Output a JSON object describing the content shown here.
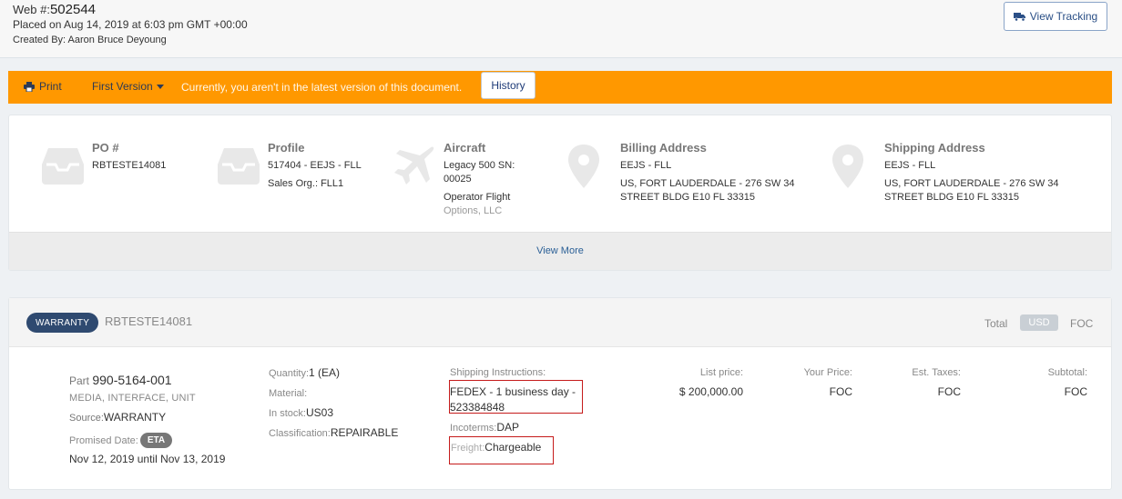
{
  "header": {
    "web_label": "Web #:",
    "web_number": "502544",
    "placed": "Placed on Aug 14, 2019 at 6:03 pm GMT +00:00",
    "created_by": "Created By: Aaron Bruce Deyoung",
    "tracking_button": "View Tracking"
  },
  "toolbar": {
    "print_label": "Print",
    "version_label": "First Version",
    "message": "Currently, you aren't in the latest version of this document.",
    "history_label": "History",
    "bar_color": "#ff9800"
  },
  "info": {
    "po": {
      "title": "PO #",
      "value": "RBTESTE14081"
    },
    "profile": {
      "title": "Profile",
      "line1": "517404 - EEJS - FLL",
      "line2": "Sales Org.: FLL1"
    },
    "aircraft": {
      "title": "Aircraft",
      "line1": "Legacy 500 SN:",
      "line2": "00025",
      "line3": "Operator Flight",
      "line4": "Options, LLC"
    },
    "billing": {
      "title": "Billing Address",
      "line1": "EEJS - FLL",
      "line2": "US, FORT LAUDERDALE - 276 SW 34",
      "line3": "STREET BLDG E10 FL 33315"
    },
    "shipping": {
      "title": "Shipping Address",
      "line1": "EEJS - FLL",
      "line2": "US, FORT LAUDERDALE - 276 SW 34",
      "line3": "STREET BLDG E10 FL 33315"
    },
    "view_more": "View More"
  },
  "item": {
    "badge": "WARRANTY",
    "po": "RBTESTE14081",
    "total_label": "Total",
    "currency": "USD",
    "total_value": "FOC",
    "part_label": "Part",
    "part_number": "990-5164-001",
    "description": "MEDIA, INTERFACE, UNIT",
    "source_label": "Source:",
    "source_value": "WARRANTY",
    "promised_label": "Promised Date:",
    "eta": "ETA",
    "date_range": "Nov 12, 2019 until Nov 13, 2019",
    "quantity_label": "Quantity:",
    "quantity_value": "1 (EA)",
    "material_label": "Material:",
    "material_value": "",
    "stock_label": "In stock:",
    "stock_value": "US03",
    "class_label": "Classification:",
    "class_value": "REPAIRABLE",
    "ship_label": "Shipping Instructions:",
    "ship_value": "FEDEX - 1 business day - 523384848",
    "incoterms_label": "Incoterms:",
    "incoterms_value": "DAP",
    "freight_label": "Freight:",
    "freight_value": "Chargeable",
    "list_price_label": "List price:",
    "list_price_value": "$ 200,000.00",
    "your_price_label": "Your Price:",
    "your_price_value": "FOC",
    "taxes_label": "Est. Taxes:",
    "taxes_value": "FOC",
    "subtotal_label": "Subtotal:",
    "subtotal_value": "FOC"
  }
}
